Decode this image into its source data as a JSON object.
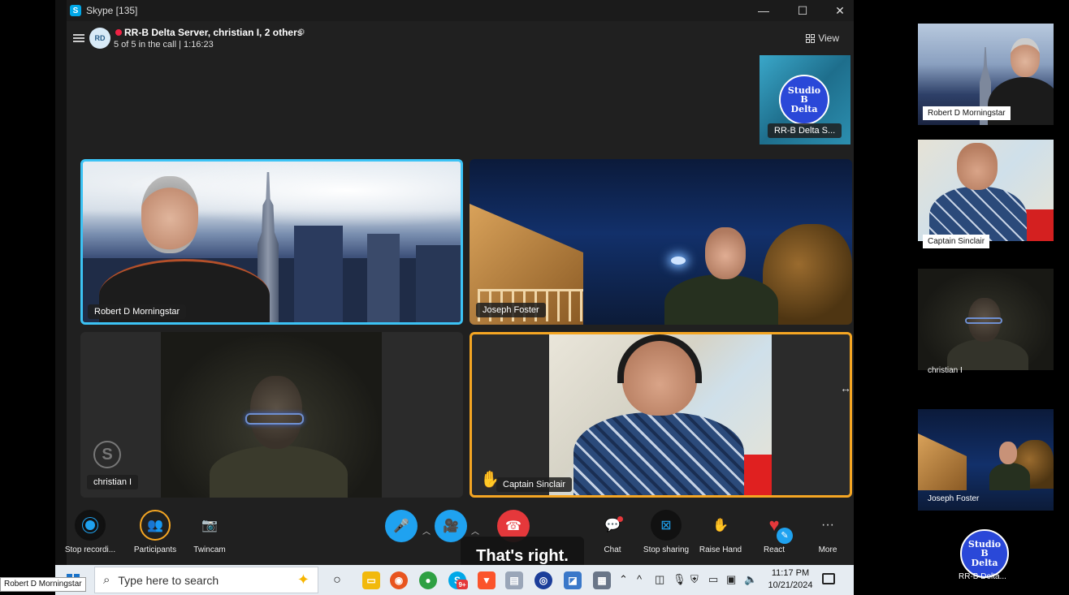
{
  "window": {
    "title": "Skype [135]",
    "minimize_icon": "minimize-icon",
    "maximize_icon": "maximize-icon",
    "close_icon": "close-icon"
  },
  "call": {
    "avatar_initials": "RD",
    "title": "RR-B Delta Server, christian I, 2 others",
    "subtitle": "5 of 5 in the call | 1:16:23",
    "view_label": "View"
  },
  "studio_tile": {
    "logo_lines": [
      "Studio",
      "B",
      "Delta"
    ],
    "name": "RR-B Delta S..."
  },
  "participants": [
    {
      "name": "Robert D Morningstar"
    },
    {
      "name": "Joseph Foster"
    },
    {
      "name": "christian I"
    },
    {
      "name": "Captain Sinclair"
    }
  ],
  "toolbar": {
    "stop_recording": "Stop recordi...",
    "participants": "Participants",
    "twincam": "Twincam",
    "chat": "Chat",
    "stop_sharing": "Stop sharing",
    "raise_hand": "Raise Hand",
    "react": "React",
    "more": "More"
  },
  "caption": "That's right.",
  "taskbar": {
    "search_placeholder": "Type here to search",
    "time": "11:17 PM",
    "date": "10/21/2024",
    "skype_badge": "9+"
  },
  "tooltip": "Robert D Morningstar",
  "side_panel": [
    {
      "name": "Robert D Morningstar"
    },
    {
      "name": "Captain Sinclair"
    },
    {
      "name": "christian I"
    },
    {
      "name": "Joseph Foster"
    },
    {
      "name": "RR-B Delta..."
    }
  ],
  "colors": {
    "active_speaker_border": "#3cc3f5",
    "raised_hand_border": "#f5a623",
    "accent_blue": "#1fa2f0",
    "end_call_red": "#e5383b"
  }
}
